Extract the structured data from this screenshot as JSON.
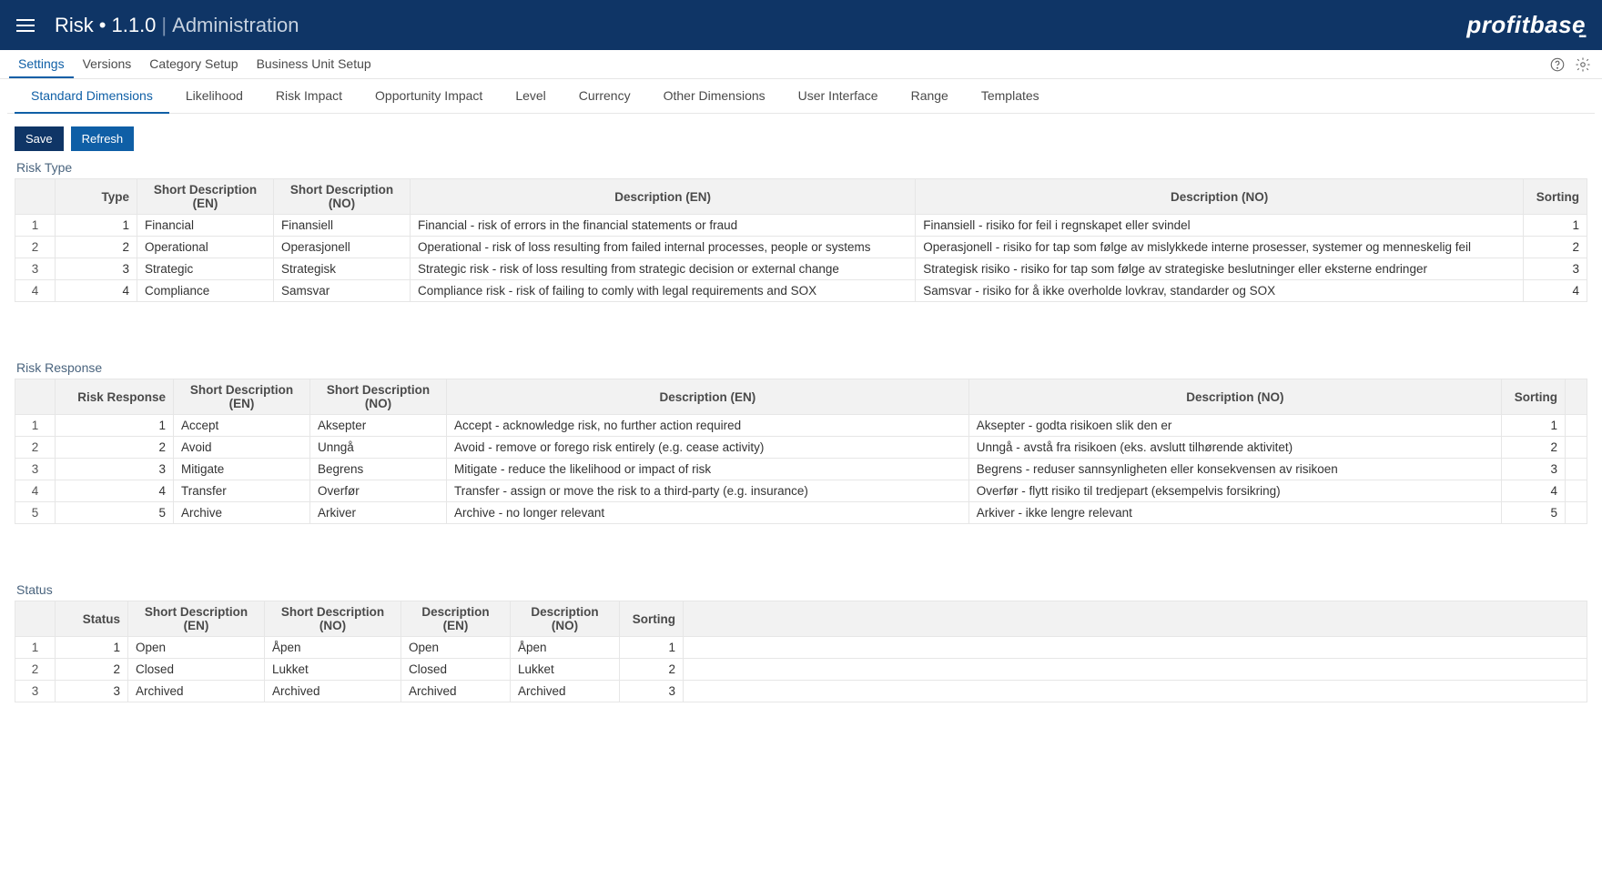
{
  "header": {
    "title_main": "Risk",
    "title_version": "1.1.0",
    "title_sub": "Administration",
    "brand": "profitbase"
  },
  "nav": {
    "items": [
      "Settings",
      "Versions",
      "Category Setup",
      "Business Unit Setup"
    ],
    "active_index": 0
  },
  "tabs": {
    "items": [
      "Standard Dimensions",
      "Likelihood",
      "Risk Impact",
      "Opportunity Impact",
      "Level",
      "Currency",
      "Other Dimensions",
      "User Interface",
      "Range",
      "Templates"
    ],
    "active_index": 0
  },
  "buttons": {
    "save": "Save",
    "refresh": "Refresh"
  },
  "sections": {
    "risk_type": {
      "title": "Risk Type",
      "headers": [
        "",
        "Type",
        "Short Description (EN)",
        "Short Description (NO)",
        "Description (EN)",
        "Description (NO)",
        "Sorting"
      ],
      "rows": [
        {
          "rn": "1",
          "type": "1",
          "sd_en": "Financial",
          "sd_no": "Finansiell",
          "d_en": "Financial - risk of errors in the financial statements or fraud",
          "d_no": "Finansiell - risiko for feil i regnskapet eller svindel",
          "sort": "1"
        },
        {
          "rn": "2",
          "type": "2",
          "sd_en": "Operational",
          "sd_no": "Operasjonell",
          "d_en": "Operational - risk of loss resulting from failed internal processes, people or systems",
          "d_no": "Operasjonell - risiko for tap som følge av mislykkede interne prosesser, systemer og menneskelig feil",
          "sort": "2"
        },
        {
          "rn": "3",
          "type": "3",
          "sd_en": "Strategic",
          "sd_no": "Strategisk",
          "d_en": "Strategic risk - risk of loss resulting from strategic decision or external change",
          "d_no": "Strategisk risiko - risiko for tap som følge av strategiske beslutninger eller eksterne endringer",
          "sort": "3"
        },
        {
          "rn": "4",
          "type": "4",
          "sd_en": "Compliance",
          "sd_no": "Samsvar",
          "d_en": "Compliance risk - risk of failing to comly with legal requirements and SOX",
          "d_no": "Samsvar - risiko for å ikke overholde lovkrav, standarder og SOX",
          "sort": "4"
        }
      ]
    },
    "risk_response": {
      "title": "Risk Response",
      "headers": [
        "",
        "Risk Response",
        "Short Description (EN)",
        "Short Description (NO)",
        "Description (EN)",
        "Description (NO)",
        "Sorting",
        ""
      ],
      "rows": [
        {
          "rn": "1",
          "rr": "1",
          "sd_en": "Accept",
          "sd_no": "Aksepter",
          "d_en": "Accept - acknowledge risk, no further action required",
          "d_no": "Aksepter - godta risikoen slik den er",
          "sort": "1"
        },
        {
          "rn": "2",
          "rr": "2",
          "sd_en": "Avoid",
          "sd_no": "Unngå",
          "d_en": "Avoid - remove or forego risk entirely (e.g. cease activity)",
          "d_no": "Unngå - avstå fra risikoen (eks. avslutt tilhørende aktivitet)",
          "sort": "2"
        },
        {
          "rn": "3",
          "rr": "3",
          "sd_en": "Mitigate",
          "sd_no": "Begrens",
          "d_en": "Mitigate - reduce the likelihood or impact of risk",
          "d_no": "Begrens - reduser sannsynligheten eller konsekvensen av risikoen",
          "sort": "3"
        },
        {
          "rn": "4",
          "rr": "4",
          "sd_en": "Transfer",
          "sd_no": "Overfør",
          "d_en": "Transfer - assign or move the risk to a third-party (e.g. insurance)",
          "d_no": "Overfør - flytt risiko til tredjepart (eksempelvis forsikring)",
          "sort": "4"
        },
        {
          "rn": "5",
          "rr": "5",
          "sd_en": "Archive",
          "sd_no": "Arkiver",
          "d_en": "Archive - no longer relevant",
          "d_no": "Arkiver - ikke lengre relevant",
          "sort": "5"
        }
      ]
    },
    "status": {
      "title": "Status",
      "headers": [
        "",
        "Status",
        "Short Description (EN)",
        "Short Description (NO)",
        "Description (EN)",
        "Description (NO)",
        "Sorting",
        ""
      ],
      "rows": [
        {
          "rn": "1",
          "st": "1",
          "sd_en": "Open",
          "sd_no": "Åpen",
          "d_en": "Open",
          "d_no": "Åpen",
          "sort": "1"
        },
        {
          "rn": "2",
          "st": "2",
          "sd_en": "Closed",
          "sd_no": "Lukket",
          "d_en": "Closed",
          "d_no": "Lukket",
          "sort": "2"
        },
        {
          "rn": "3",
          "st": "3",
          "sd_en": "Archived",
          "sd_no": "Archived",
          "d_en": "Archived",
          "d_no": "Archived",
          "sort": "3"
        }
      ]
    }
  }
}
